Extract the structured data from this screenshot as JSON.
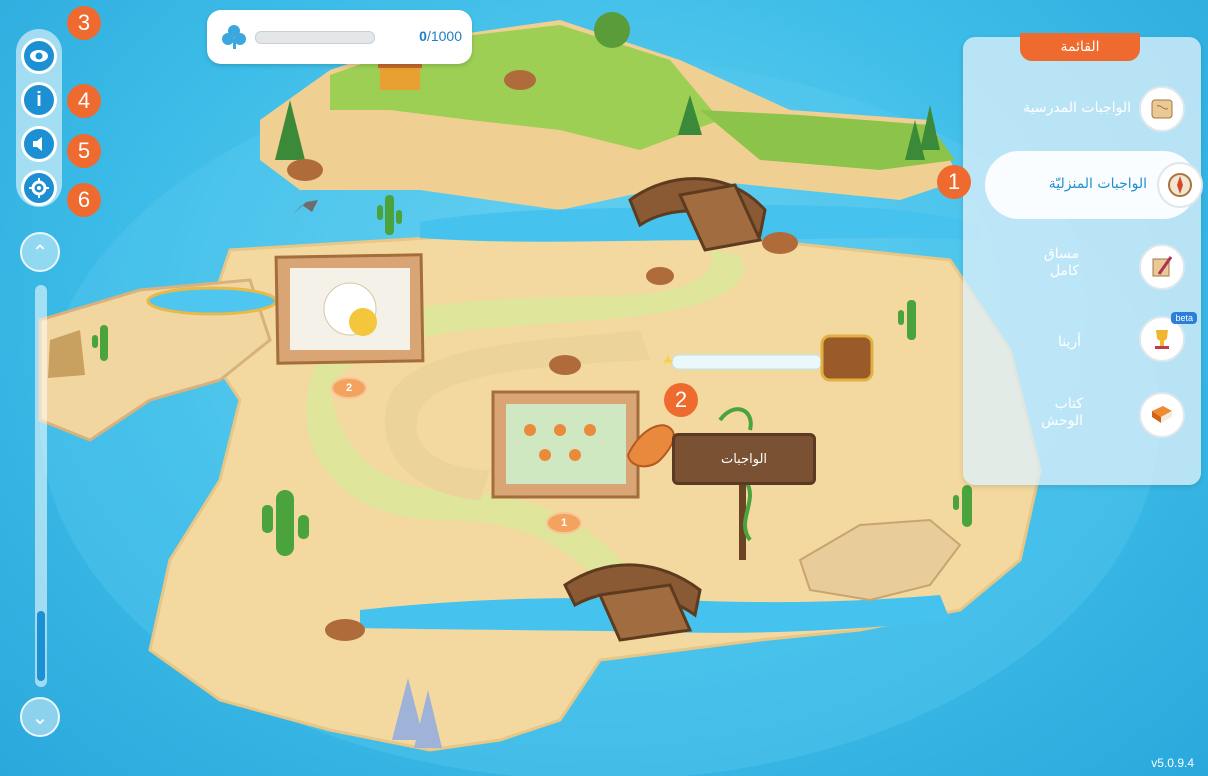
{
  "score": {
    "current": "0",
    "total": "/1000",
    "progress": 0
  },
  "toolbar": {
    "buttons": [
      {
        "icon": "eye-icon",
        "badge": "3"
      },
      {
        "icon": "info-icon",
        "badge": "4",
        "glyph": "i"
      },
      {
        "icon": "speaker-icon",
        "badge": "5"
      },
      {
        "icon": "target-icon",
        "badge": "6"
      }
    ]
  },
  "menu": {
    "title": "القائمة",
    "items": [
      {
        "label": "الواجبات المدرسية",
        "icon": "map-scroll-icon"
      },
      {
        "label": "الواجبات المنزليّة",
        "icon": "compass-icon",
        "badge": "1"
      },
      {
        "label": "مساق كامل",
        "icon": "quill-icon"
      },
      {
        "label": "أرينا",
        "icon": "trophy-icon",
        "tag": "beta"
      },
      {
        "label": "كتاب الوحش",
        "icon": "book-icon"
      }
    ]
  },
  "map": {
    "level_badges": [
      "2",
      "1"
    ],
    "sign_label": "الواجبات",
    "hint_badge": "2"
  },
  "version": "v5.0.9.4",
  "colors": {
    "accent": "#ef6a2e",
    "primary": "#1d8fd3",
    "water": "#3dbde8",
    "sand": "#f3d9a0"
  }
}
